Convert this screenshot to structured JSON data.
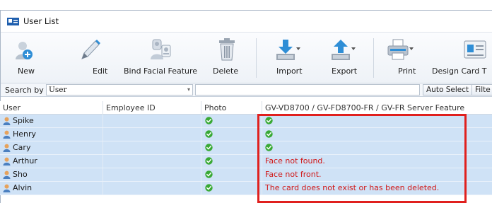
{
  "window": {
    "title": "User List"
  },
  "toolbar": {
    "buttons": [
      {
        "id": "new",
        "label": "New",
        "icon": "user-add-icon"
      },
      {
        "id": "edit",
        "label": "Edit",
        "icon": "pencil-icon"
      },
      {
        "id": "bind",
        "label": "Bind Facial Feature",
        "icon": "face-bind-icon"
      },
      {
        "id": "delete",
        "label": "Delete",
        "icon": "trash-icon"
      },
      {
        "id": "import",
        "label": "Import",
        "icon": "import-icon"
      },
      {
        "id": "export",
        "label": "Export",
        "icon": "export-icon"
      },
      {
        "id": "print",
        "label": "Print",
        "icon": "printer-icon"
      },
      {
        "id": "design",
        "label": "Design Card T",
        "icon": "card-design-icon"
      }
    ]
  },
  "search": {
    "label": "Search by",
    "field_value": "User",
    "query_value": "",
    "auto_select_label": "Auto Select",
    "filter_label": "Filte"
  },
  "grid": {
    "columns": [
      "User",
      "Employee ID",
      "Photo",
      "GV-VD8700 / GV-FD8700-FR / GV-FR Server Feature"
    ],
    "rows": [
      {
        "user": "Spike",
        "employee_id": "",
        "photo": "ok",
        "feature_status": "ok",
        "feature_message": ""
      },
      {
        "user": "Henry",
        "employee_id": "",
        "photo": "ok",
        "feature_status": "ok",
        "feature_message": ""
      },
      {
        "user": "Cary",
        "employee_id": "",
        "photo": "ok",
        "feature_status": "ok",
        "feature_message": ""
      },
      {
        "user": "Arthur",
        "employee_id": "",
        "photo": "ok",
        "feature_status": "error",
        "feature_message": "Face not found."
      },
      {
        "user": "Sho",
        "employee_id": "",
        "photo": "ok",
        "feature_status": "error",
        "feature_message": "Face not front."
      },
      {
        "user": "Alvin",
        "employee_id": "",
        "photo": "ok",
        "feature_status": "error",
        "feature_message": "The card does not exist or has been deleted."
      }
    ]
  },
  "colors": {
    "row_selected": "#cfe2f6",
    "ok_green": "#39a935",
    "error_text": "#d01818",
    "highlight_border": "#e0201e"
  }
}
